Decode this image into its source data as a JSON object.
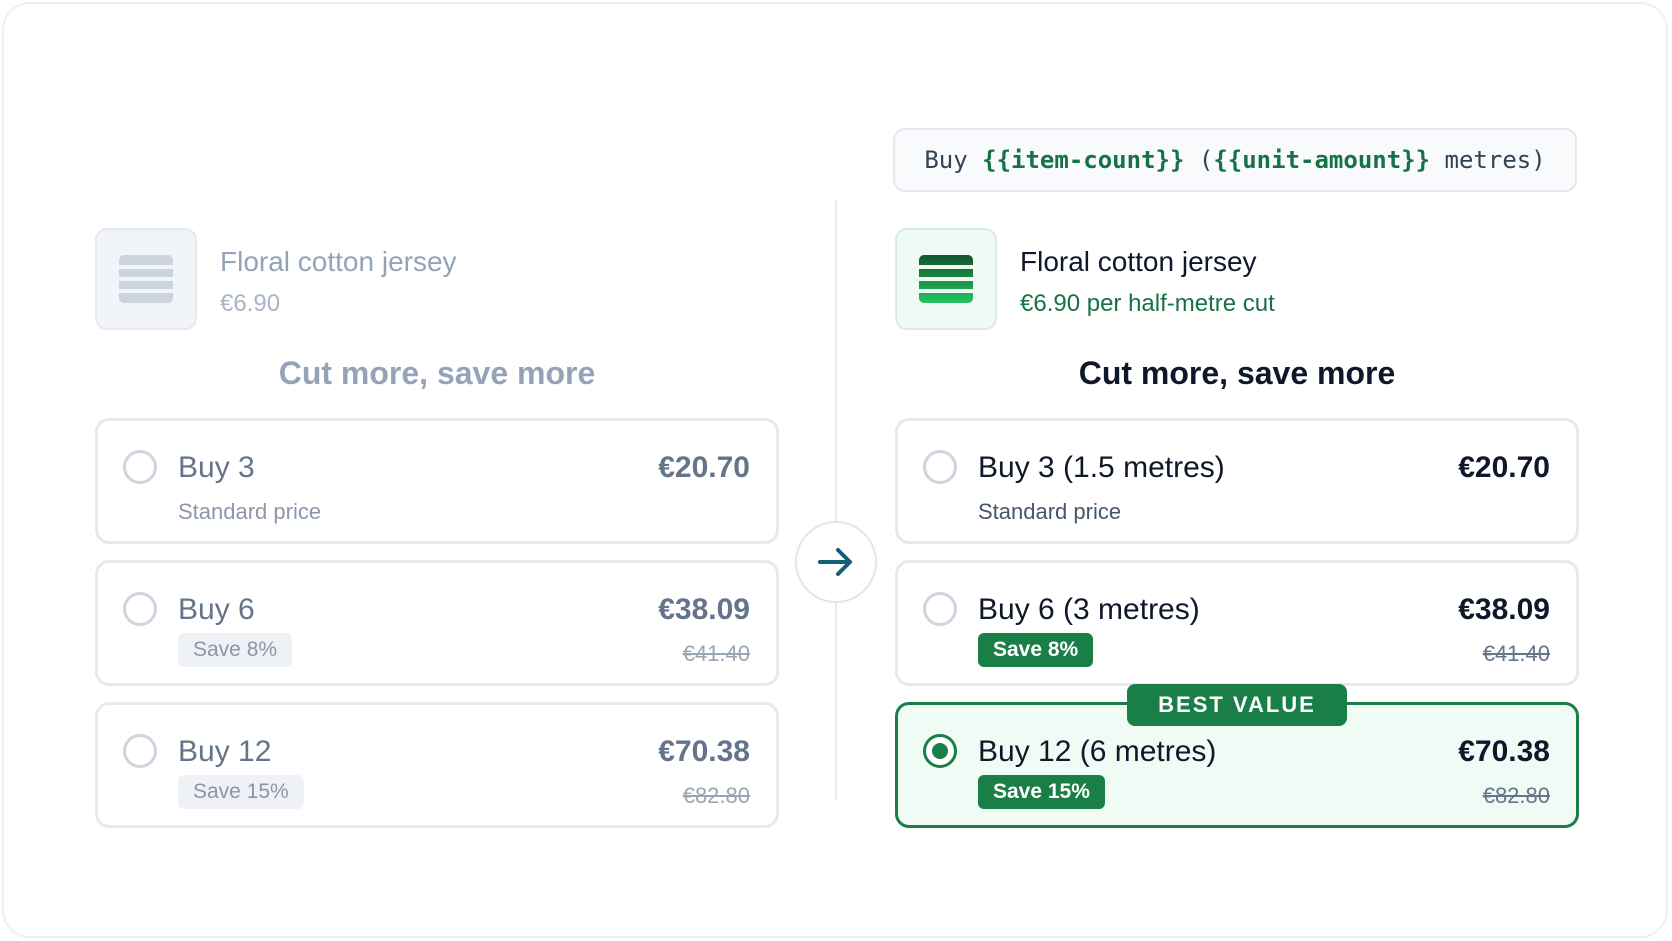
{
  "template": {
    "prefix": "Buy ",
    "var1": "{{item-count}}",
    "mid1": " (",
    "var2": "{{unit-amount}}",
    "suffix": " metres)"
  },
  "colors": {
    "accent_green": "#1a7f47",
    "muted_text": "#94a3b8",
    "border": "#e6eaef"
  },
  "before": {
    "product": {
      "name": "Floral cotton jersey",
      "price": "€6.90"
    },
    "heading": "Cut more, save more",
    "tiers": [
      {
        "title": "Buy 3",
        "subtitle": "Standard price",
        "price": "€20.70",
        "old_price": "",
        "badge": "",
        "selected": false
      },
      {
        "title": "Buy 6",
        "subtitle": "",
        "price": "€38.09",
        "old_price": "€41.40",
        "badge": "Save 8%",
        "selected": false
      },
      {
        "title": "Buy 12",
        "subtitle": "",
        "price": "€70.38",
        "old_price": "€82.80",
        "badge": "Save 15%",
        "selected": false
      }
    ]
  },
  "after": {
    "product": {
      "name": "Floral cotton jersey",
      "price": "€6.90 per half-metre cut"
    },
    "heading": "Cut more, save more",
    "best_value_label": "BEST VALUE",
    "tiers": [
      {
        "title": "Buy 3 (1.5 metres)",
        "subtitle": "Standard price",
        "price": "€20.70",
        "old_price": "",
        "badge": "",
        "selected": false
      },
      {
        "title": "Buy 6 (3 metres)",
        "subtitle": "",
        "price": "€38.09",
        "old_price": "€41.40",
        "badge": "Save 8%",
        "selected": false
      },
      {
        "title": "Buy 12 (6 metres)",
        "subtitle": "",
        "price": "€70.38",
        "old_price": "€82.80",
        "badge": "Save 15%",
        "selected": true
      }
    ]
  },
  "icons": {
    "transition": "arrow-right-icon",
    "product": "fabric-swatch-icon",
    "option": "radio-icon"
  }
}
